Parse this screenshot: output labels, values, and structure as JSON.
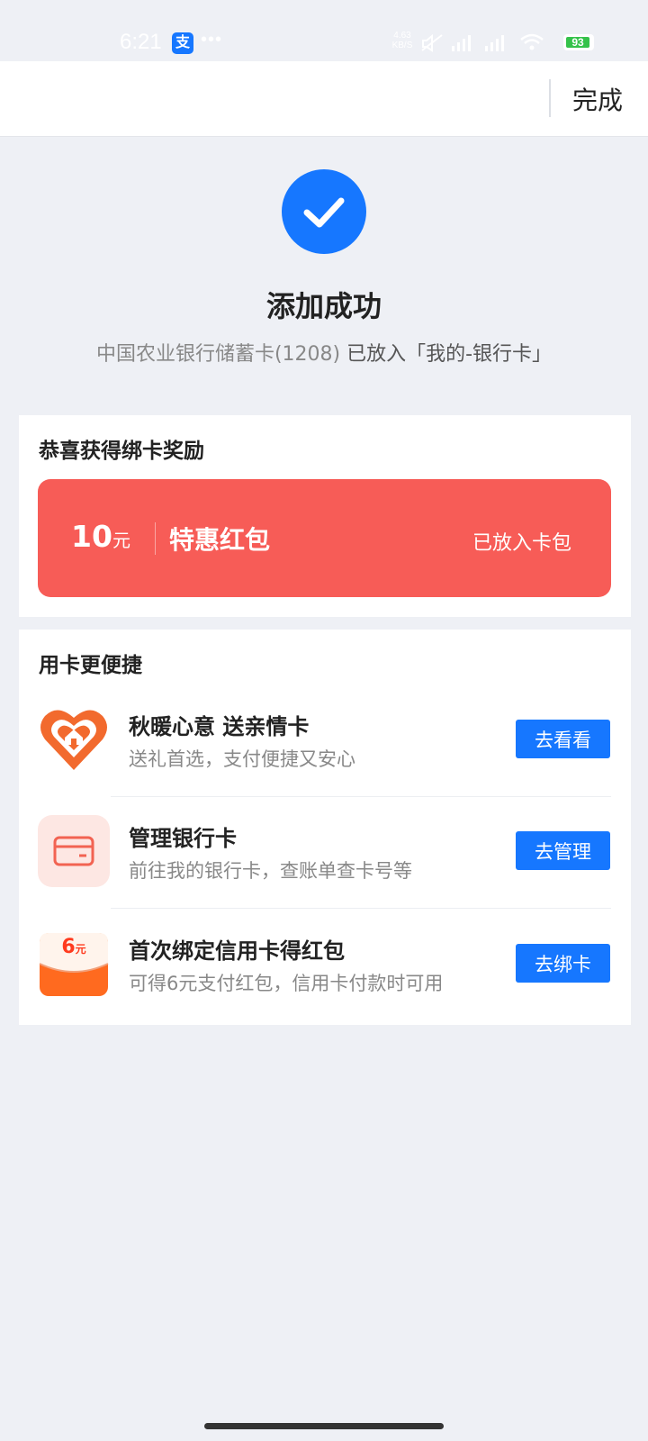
{
  "status_bar": {
    "time": "6:21",
    "app_badge": "支",
    "more": "•••",
    "net_speed_value": "4.63",
    "net_speed_unit": "KB/S",
    "battery": "93"
  },
  "header": {
    "done_label": "完成"
  },
  "success": {
    "title": "添加成功",
    "card_name": "中国农业银行储蓄卡(1208)",
    "placed_text": " 已放入「我的-银行卡」"
  },
  "reward": {
    "section_title": "恭喜获得绑卡奖励",
    "amount": "10",
    "unit": "元",
    "name": "特惠红包",
    "status": "已放入卡包"
  },
  "convenience": {
    "section_title": "用卡更便捷",
    "items": [
      {
        "title": "秋暖心意 送亲情卡",
        "desc": "送礼首选，支付便捷又安心",
        "button": "去看看",
        "icon": "family-card-heart-icon"
      },
      {
        "title": "管理银行卡",
        "desc": "前往我的银行卡，查账单查卡号等",
        "button": "去管理",
        "icon": "bank-card-icon"
      },
      {
        "title": "首次绑定信用卡得红包",
        "desc": "可得6元支付红包，信用卡付款时可用",
        "button": "去绑卡",
        "icon": "red-envelope-icon",
        "badge": "6",
        "badge_unit": "元"
      }
    ]
  },
  "colors": {
    "primary": "#1677ff",
    "red_packet": "#f75c57",
    "background": "#eef0f5"
  }
}
